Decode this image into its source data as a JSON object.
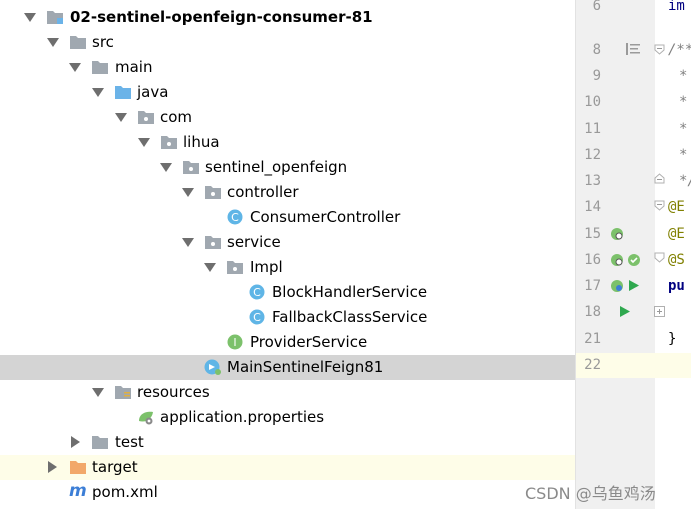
{
  "project_tree": {
    "items": [
      {
        "label": "02-sentinel-openfeign-consumer-81"
      },
      {
        "label": "src"
      },
      {
        "label": "main"
      },
      {
        "label": "java"
      },
      {
        "label": "com"
      },
      {
        "label": "lihua"
      },
      {
        "label": "sentinel_openfeign"
      },
      {
        "label": "controller"
      },
      {
        "label": "ConsumerController",
        "badge": "C"
      },
      {
        "label": "service"
      },
      {
        "label": "Impl"
      },
      {
        "label": "BlockHandlerService",
        "badge": "C"
      },
      {
        "label": "FallbackClassService",
        "badge": "C"
      },
      {
        "label": "ProviderService",
        "badge": "I"
      },
      {
        "label": "MainSentinelFeign81"
      },
      {
        "label": "resources"
      },
      {
        "label": "application.properties"
      },
      {
        "label": "test"
      },
      {
        "label": "target"
      },
      {
        "label": "pom.xml",
        "badge": "m"
      }
    ]
  },
  "editor": {
    "line_numbers": [
      "6",
      "8",
      "9",
      "10",
      "11",
      "12",
      "13",
      "14",
      "15",
      "16",
      "17",
      "18",
      "21",
      "22"
    ],
    "code": [
      "im",
      "/**",
      "*",
      "*",
      "*",
      "*",
      "*/",
      "@E",
      "@E",
      "@S",
      "pu",
      "}"
    ]
  },
  "watermark": "CSDN @乌鱼鸡汤",
  "colors": {
    "selection": "#d4d4d4",
    "highlight_row": "#fefde8",
    "folder": "#a0a8b0",
    "source_folder": "#6bb3e8",
    "class_badge": "#5fb5e6",
    "interface_badge": "#7cc16b",
    "target_folder": "#f2a86a"
  }
}
